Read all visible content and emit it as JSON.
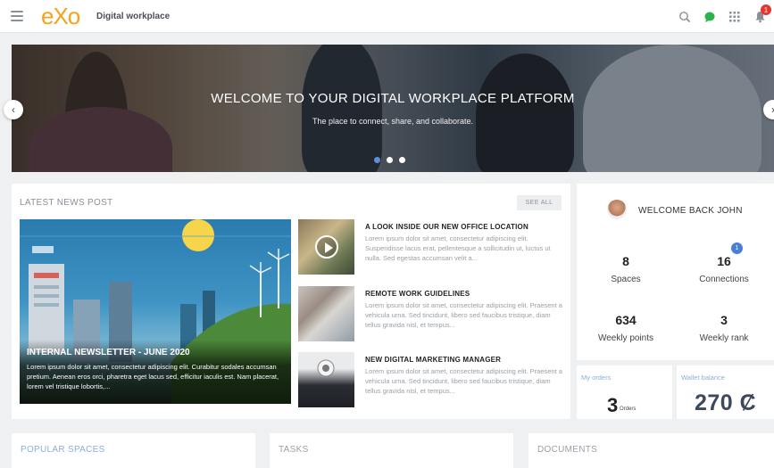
{
  "header": {
    "logo": "eXo",
    "title": "Digital workplace",
    "notification_count": "1"
  },
  "hero": {
    "title": "WELCOME TO YOUR DIGITAL WORKPLACE PLATFORM",
    "subtitle": "The place to connect, share, and collaborate.",
    "slide_count": 3,
    "active_slide": 1
  },
  "news": {
    "heading": "LATEST NEWS POST",
    "see_all": "SEE ALL",
    "featured": {
      "title": "INTERNAL NEWSLETTER - JUNE 2020",
      "text": "Lorem ipsum dolor sit amet, consectetur adipiscing elit. Curabitur sodales accumsan pretium. Aenean eros orci, pharetra eget lacus sed, efficitur iaculis est. Nam placerat, lorem vel tristique lobortis,..."
    },
    "items": [
      {
        "title": "A LOOK INSIDE OUR NEW OFFICE LOCATION",
        "text": "Lorem ipsum dolor sit amet, consectetur adipiscing elit. Suspendisse lacus erat, pellentesque a sollicitudin ut, luctus ut nulla. Sed egestas accumsan velit a..."
      },
      {
        "title": "REMOTE WORK GUIDELINES",
        "text": "Lorem ipsum dolor sit amet, consectetur adipiscing elit. Praesent a vehicula urna. Sed tincidunt, libero sed faucibus tristique, diam tellus gravida nisl, et tempus..."
      },
      {
        "title": "NEW DIGITAL MARKETING MANAGER",
        "text": "Lorem ipsum dolor sit amet, consectetur adipiscing elit. Praesent a vehicula urna. Sed tincidunt, libero sed faucibus tristique, diam tellus gravida nisl, et tempus..."
      }
    ]
  },
  "profile": {
    "welcome": "WELCOME BACK JOHN",
    "stats": [
      {
        "value": "8",
        "label": "Spaces"
      },
      {
        "value": "16",
        "label": "Connections"
      },
      {
        "value": "634",
        "label": "Weekly points"
      },
      {
        "value": "3",
        "label": "Weekly rank"
      }
    ],
    "connections_badge": "1"
  },
  "orders": {
    "label": "My orders",
    "value": "3",
    "unit": "Orders"
  },
  "wallet": {
    "label": "Wallet balance",
    "value": "270 Ȼ"
  },
  "bottom": {
    "popular_spaces": "POPULAR SPACES",
    "tasks": "TASKS",
    "documents": "DOCUMENTS"
  },
  "colors": {
    "brand_orange": "#f7a318",
    "accent_blue": "#5b8fd6",
    "badge_red": "#e5372f",
    "chat_green": "#2bb24c"
  },
  "icons": [
    "menu-icon",
    "search-icon",
    "chat-icon",
    "apps-grid-icon",
    "notification-bell-icon",
    "chevron-left-icon",
    "chevron-right-icon",
    "play-icon"
  ]
}
